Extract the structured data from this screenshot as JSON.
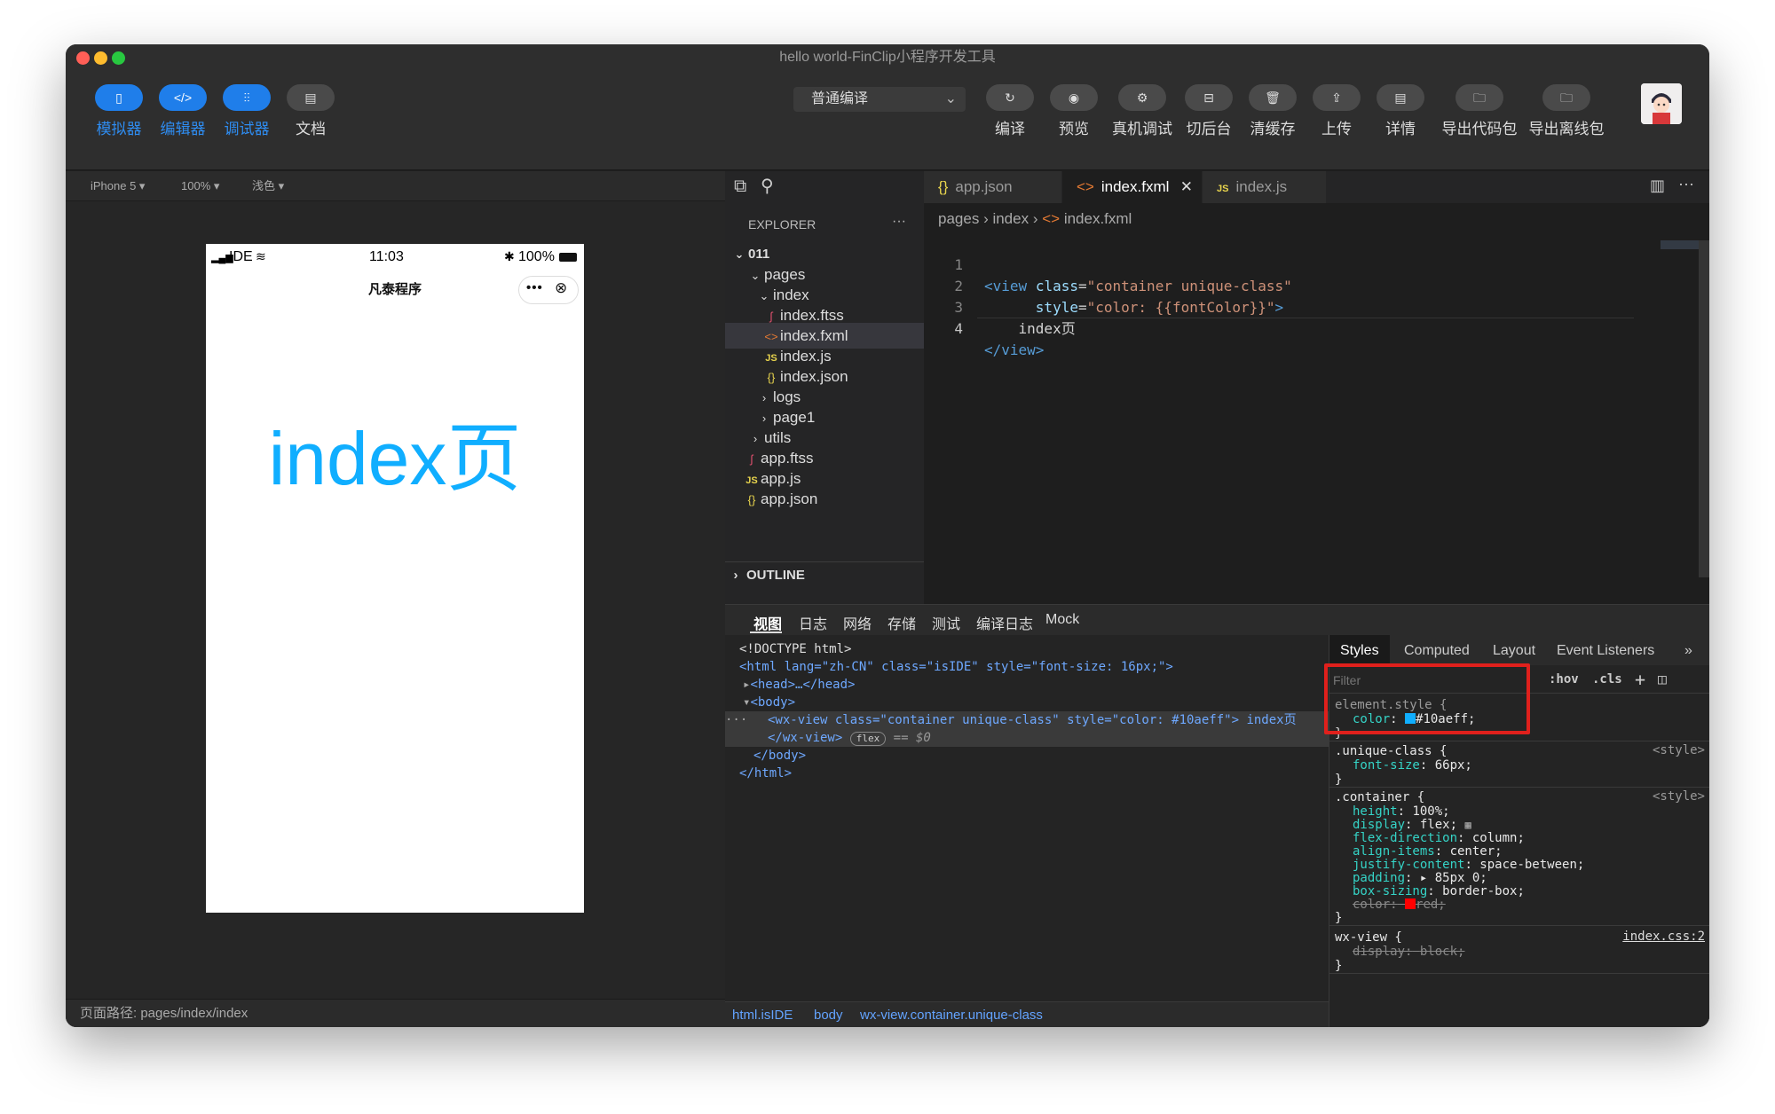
{
  "window": {
    "title": "hello world-FinClip小程序开发工具"
  },
  "toolbar": {
    "left_buttons": [
      {
        "label": "模拟器",
        "icon": "phone-icon",
        "active": true
      },
      {
        "label": "编辑器",
        "icon": "code-icon",
        "active": true
      },
      {
        "label": "调试器",
        "icon": "sliders-icon",
        "active": true
      },
      {
        "label": "文档",
        "icon": "document-icon",
        "active": false
      }
    ],
    "compile_mode": "普通编译",
    "right_buttons": [
      {
        "label": "编译",
        "icon": "refresh-icon"
      },
      {
        "label": "预览",
        "icon": "eye-icon"
      },
      {
        "label": "真机调试",
        "icon": "debug-icon"
      },
      {
        "label": "切后台",
        "icon": "switch-icon"
      },
      {
        "label": "清缓存",
        "icon": "trash-icon"
      },
      {
        "label": "上传",
        "icon": "upload-icon"
      },
      {
        "label": "详情",
        "icon": "details-icon"
      },
      {
        "label": "导出代码包",
        "icon": "folder-icon"
      },
      {
        "label": "导出离线包",
        "icon": "folder-icon"
      }
    ]
  },
  "simulator": {
    "device": "iPhone 5 ▾",
    "zoom": "100% ▾",
    "theme": "浅色 ▾",
    "status_carrier": "IDE",
    "status_time": "11:03",
    "status_battery": "100%",
    "nav_title": "凡泰程序",
    "content_text": "index页",
    "content_color": "#10aeff",
    "page_path": "页面路径: pages/index/index"
  },
  "explorer": {
    "title": "EXPLORER",
    "project": "011",
    "items": [
      {
        "label": "pages",
        "type": "folder-open"
      },
      {
        "label": "index",
        "type": "folder-open"
      },
      {
        "label": "index.ftss",
        "type": "ftss"
      },
      {
        "label": "index.fxml",
        "type": "fxml"
      },
      {
        "label": "index.js",
        "type": "js"
      },
      {
        "label": "index.json",
        "type": "json"
      },
      {
        "label": "logs",
        "type": "folder"
      },
      {
        "label": "page1",
        "type": "folder"
      },
      {
        "label": "utils",
        "type": "folder"
      },
      {
        "label": "app.ftss",
        "type": "ftss"
      },
      {
        "label": "app.js",
        "type": "js"
      },
      {
        "label": "app.json",
        "type": "json"
      }
    ],
    "outline": "OUTLINE"
  },
  "editor": {
    "tabs": [
      {
        "label": "app.json",
        "prefix": "{}"
      },
      {
        "label": "index.fxml",
        "prefix": "<>"
      },
      {
        "label": "index.js",
        "prefix": "JS"
      }
    ],
    "breadcrumb": [
      "pages",
      "index",
      "index.fxml"
    ],
    "lines": [
      {
        "num": "1",
        "text": "<view class=\"container unique-class\""
      },
      {
        "num": "2",
        "text": "    style=\"color: {{fontColor}}\">"
      },
      {
        "num": "3",
        "text": "  index页"
      },
      {
        "num": "4",
        "text": "</view>"
      }
    ]
  },
  "devtools": {
    "tabs": [
      "视图",
      "日志",
      "网络",
      "存储",
      "测试",
      "编译日志",
      "Mock"
    ],
    "elements": {
      "doctype": "<!DOCTYPE html>",
      "html_open": "<html lang=\"zh-CN\" class=\"isIDE\" style=\"font-size: 16px;\">",
      "head": "<head>…</head>",
      "body_open": "<body>",
      "wx_view_open": "<wx-view class=\"container unique-class\" style=\"color: #10aeff\"> index页",
      "wx_view_close": "</wx-view>",
      "flex_badge": "flex",
      "selected_marker": "== $0",
      "body_close": "</body>",
      "html_close": "</html>"
    },
    "breadcrumbs": [
      "html.isIDE",
      "body",
      "wx-view.container.unique-class"
    ],
    "styles_tabs": [
      "Styles",
      "Computed",
      "Layout",
      "Event Listeners",
      "»"
    ],
    "filter_placeholder": "Filter",
    "hov": ":hov",
    "cls": ".cls",
    "rules": {
      "element_style": {
        "selector": "element.style {",
        "prop": "color",
        "value": "#10aeff;",
        "swatch": "#10aeff"
      },
      "unique_class": {
        "selector": ".unique-class {",
        "source": "<style>",
        "prop": "font-size",
        "value": "66px;"
      },
      "container": {
        "selector": ".container {",
        "source": "<style>",
        "props": [
          {
            "name": "height",
            "value": "100%;"
          },
          {
            "name": "display",
            "value": "flex;"
          },
          {
            "name": "flex-direction",
            "value": "column;"
          },
          {
            "name": "align-items",
            "value": "center;"
          },
          {
            "name": "justify-content",
            "value": "space-between;"
          },
          {
            "name": "padding",
            "value": "▸ 85px 0;"
          },
          {
            "name": "box-sizing",
            "value": "border-box;"
          }
        ],
        "struck_prop": "color:",
        "struck_value": "red;",
        "struck_swatch": "#ff0000"
      },
      "wx_view": {
        "selector": "wx-view {",
        "source": "index.css:2",
        "struck_prop": "display:",
        "struck_value": "block;"
      }
    }
  }
}
